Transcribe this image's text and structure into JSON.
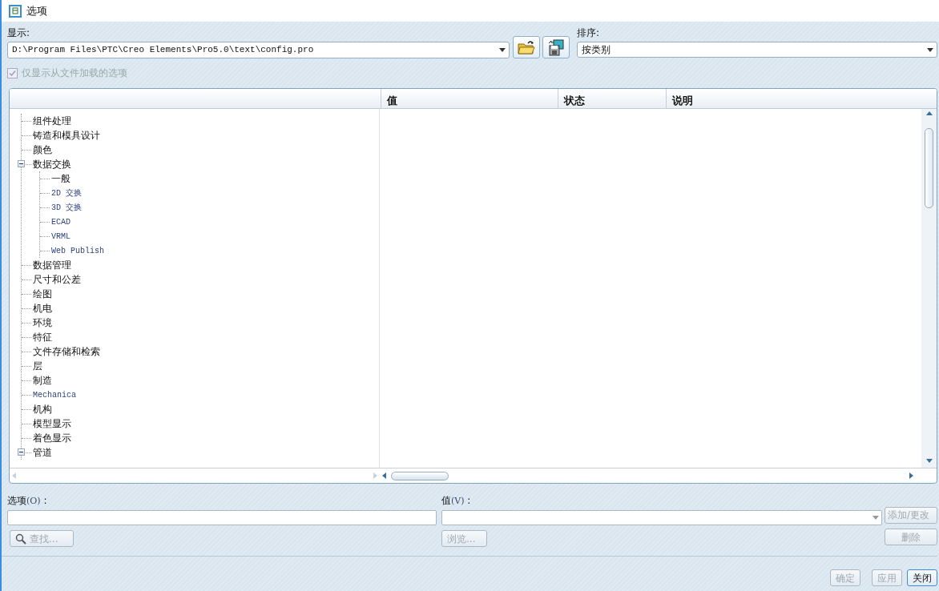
{
  "window": {
    "title": "选项"
  },
  "display": {
    "label": "显示:",
    "value": "D:\\Program Files\\PTC\\Creo Elements\\Pro5.0\\text\\config.pro"
  },
  "sort": {
    "label": "排序:",
    "value": "按类别"
  },
  "loaded_only": {
    "label": "仅显示从文件加载的选项",
    "checked": true,
    "disabled": true
  },
  "table": {
    "columns": [
      "值",
      "状态",
      "说明"
    ]
  },
  "tree": [
    {
      "label": "组件处理",
      "kind": "cjk"
    },
    {
      "label": "铸造和模具设计",
      "kind": "cjk"
    },
    {
      "label": "颜色",
      "kind": "cjk"
    },
    {
      "label": "数据交换",
      "kind": "cjk",
      "expanded": true,
      "children": [
        {
          "label": "一般",
          "kind": "cjk"
        },
        {
          "label": "2D 交换",
          "kind": "latin"
        },
        {
          "label": "3D 交换",
          "kind": "latin"
        },
        {
          "label": "ECAD",
          "kind": "latin"
        },
        {
          "label": "VRML",
          "kind": "latin"
        },
        {
          "label": "Web Publish",
          "kind": "latin"
        }
      ]
    },
    {
      "label": "数据管理",
      "kind": "cjk"
    },
    {
      "label": "尺寸和公差",
      "kind": "cjk"
    },
    {
      "label": "绘图",
      "kind": "cjk"
    },
    {
      "label": "机电",
      "kind": "cjk"
    },
    {
      "label": "环境",
      "kind": "cjk"
    },
    {
      "label": "特征",
      "kind": "cjk"
    },
    {
      "label": "文件存储和检索",
      "kind": "cjk"
    },
    {
      "label": "层",
      "kind": "cjk"
    },
    {
      "label": "制造",
      "kind": "cjk"
    },
    {
      "label": "Mechanica",
      "kind": "latin"
    },
    {
      "label": "机构",
      "kind": "cjk"
    },
    {
      "label": "模型显示",
      "kind": "cjk"
    },
    {
      "label": "着色显示",
      "kind": "cjk"
    },
    {
      "label": "管道",
      "kind": "cjk",
      "expanded": true
    }
  ],
  "option": {
    "label": "选项",
    "mnemonic": "(O)",
    "colon": ":"
  },
  "value": {
    "label": "值",
    "mnemonic": "(V)",
    "colon": ":"
  },
  "buttons": {
    "add_change": {
      "label": "添加/更改",
      "disabled": true
    },
    "find": {
      "label": "查找...",
      "disabled": true
    },
    "browse": {
      "label": "浏览...",
      "disabled": true
    },
    "delete": {
      "label": "删除",
      "disabled": true
    },
    "ok": {
      "label": "确定",
      "disabled": true
    },
    "apply": {
      "label": "应用",
      "disabled": true
    },
    "close": {
      "label": "关闭",
      "disabled": false
    }
  }
}
